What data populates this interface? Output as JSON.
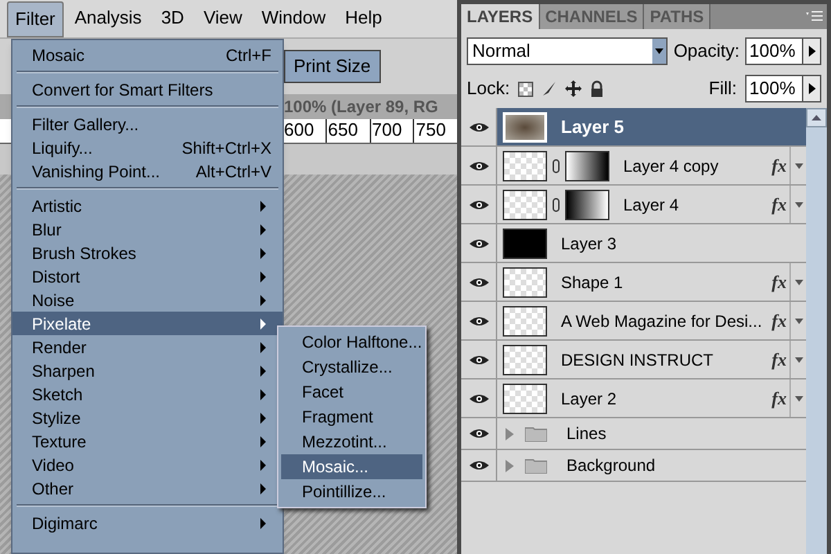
{
  "menu_bar": [
    {
      "label": "Filter",
      "selected": true
    },
    {
      "label": "Analysis",
      "selected": false
    },
    {
      "label": "3D",
      "selected": false
    },
    {
      "label": "View",
      "selected": false
    },
    {
      "label": "Window",
      "selected": false
    },
    {
      "label": "Help",
      "selected": false
    }
  ],
  "options_bar": {
    "button": "Print Size"
  },
  "document": {
    "title": "100% (Layer 89, RG",
    "ruler": [
      "600",
      "650",
      "700",
      "750"
    ]
  },
  "filter_menu": [
    {
      "kind": "item",
      "label": "Mosaic",
      "shortcut": "Ctrl+F"
    },
    {
      "kind": "separator"
    },
    {
      "kind": "item",
      "label": "Convert for Smart Filters"
    },
    {
      "kind": "separator"
    },
    {
      "kind": "item",
      "label": "Filter Gallery..."
    },
    {
      "kind": "item",
      "label": "Liquify...",
      "shortcut": "Shift+Ctrl+X"
    },
    {
      "kind": "item",
      "label": "Vanishing Point...",
      "shortcut": "Alt+Ctrl+V"
    },
    {
      "kind": "separator"
    },
    {
      "kind": "submenu",
      "label": "Artistic",
      "selected": false
    },
    {
      "kind": "submenu",
      "label": "Blur",
      "selected": false
    },
    {
      "kind": "submenu",
      "label": "Brush Strokes",
      "selected": false
    },
    {
      "kind": "submenu",
      "label": "Distort",
      "selected": false
    },
    {
      "kind": "submenu",
      "label": "Noise",
      "selected": false
    },
    {
      "kind": "submenu",
      "label": "Pixelate",
      "selected": true
    },
    {
      "kind": "submenu",
      "label": "Render",
      "selected": false
    },
    {
      "kind": "submenu",
      "label": "Sharpen",
      "selected": false
    },
    {
      "kind": "submenu",
      "label": "Sketch",
      "selected": false
    },
    {
      "kind": "submenu",
      "label": "Stylize",
      "selected": false
    },
    {
      "kind": "submenu",
      "label": "Texture",
      "selected": false
    },
    {
      "kind": "submenu",
      "label": "Video",
      "selected": false
    },
    {
      "kind": "submenu",
      "label": "Other",
      "selected": false
    },
    {
      "kind": "separator"
    },
    {
      "kind": "submenu",
      "label": "Digimarc",
      "selected": false
    }
  ],
  "pixelate_submenu": [
    {
      "label": "Color Halftone...",
      "selected": false
    },
    {
      "label": "Crystallize...",
      "selected": false
    },
    {
      "label": "Facet",
      "selected": false
    },
    {
      "label": "Fragment",
      "selected": false
    },
    {
      "label": "Mezzotint...",
      "selected": false
    },
    {
      "label": "Mosaic...",
      "selected": true
    },
    {
      "label": "Pointillize...",
      "selected": false
    }
  ],
  "layers_panel": {
    "tabs": [
      {
        "label": "LAYERS",
        "selected": true
      },
      {
        "label": "CHANNELS",
        "selected": false
      },
      {
        "label": "PATHS",
        "selected": false
      }
    ],
    "blend_mode": "Normal",
    "opacity_label": "Opacity:",
    "opacity": "100%",
    "lock_label": "Lock:",
    "fill_label": "Fill:",
    "fill": "100%",
    "layers": [
      {
        "kind": "photo",
        "name": "Layer 5",
        "selected": true,
        "mask": false
      },
      {
        "kind": "transparent",
        "name": "Layer 4 copy",
        "selected": false,
        "mask": true,
        "fx": "fx"
      },
      {
        "kind": "transparent",
        "name": "Layer 4",
        "selected": false,
        "mask": true,
        "fx": "fx"
      },
      {
        "kind": "black",
        "name": "Layer 3",
        "selected": false,
        "mask": false
      },
      {
        "kind": "transparent",
        "name": "Shape 1",
        "selected": false,
        "mask": false,
        "fx": "fx"
      },
      {
        "kind": "transparent",
        "name": "A Web Magazine for Desi...",
        "selected": false,
        "mask": false,
        "fx": "fx"
      },
      {
        "kind": "transparent",
        "name": "DESIGN INSTRUCT",
        "selected": false,
        "mask": false,
        "fx": "fx"
      },
      {
        "kind": "transparent",
        "name": "Layer 2",
        "selected": false,
        "mask": false,
        "fx": "fx"
      },
      {
        "kind": "group",
        "name": "Lines",
        "selected": false,
        "mask": false
      },
      {
        "kind": "group",
        "name": "Background",
        "selected": false,
        "mask": false
      }
    ]
  }
}
